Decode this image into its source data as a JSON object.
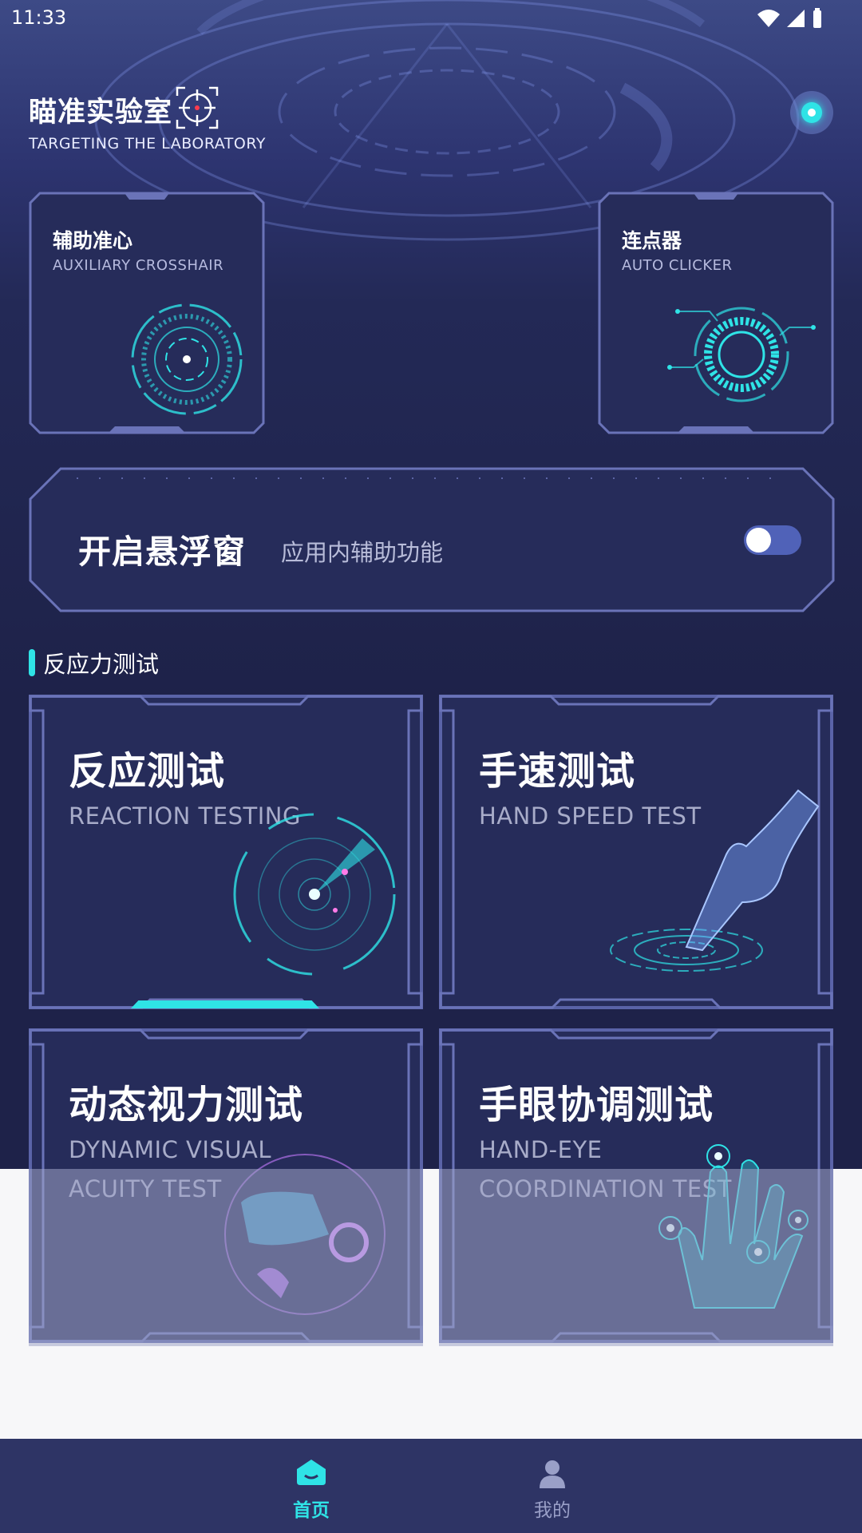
{
  "status_bar": {
    "time": "11:33"
  },
  "header": {
    "title": "瞄准实验室",
    "subtitle": "TARGETING THE LABORATORY"
  },
  "tools": [
    {
      "title": "辅助准心",
      "subtitle": "AUXILIARY CROSSHAIR"
    },
    {
      "title": "连点器",
      "subtitle": "AUTO CLICKER"
    }
  ],
  "floating_window": {
    "title": "开启悬浮窗",
    "subtitle": "应用内辅助功能",
    "enabled": false
  },
  "section": {
    "title": "反应力测试"
  },
  "tests": [
    {
      "title": "反应测试",
      "subtitle": "REACTION TESTING"
    },
    {
      "title": "手速测试",
      "subtitle": "HAND SPEED TEST"
    },
    {
      "title": "动态视力测试",
      "subtitle": "DYNAMIC VISUAL ACUITY TEST"
    },
    {
      "title": "手眼协调测试",
      "subtitle": "HAND-EYE COORDINATION TEST"
    }
  ],
  "bottom_nav": [
    {
      "label": "首页",
      "icon": "home-icon",
      "active": true
    },
    {
      "label": "我的",
      "icon": "profile-icon",
      "active": false
    }
  ],
  "colors": {
    "accent": "#2fe3e6",
    "background": "#1e2249",
    "card": "#262c5a",
    "frame": "#5a63a8",
    "nav": "#2e3465"
  }
}
